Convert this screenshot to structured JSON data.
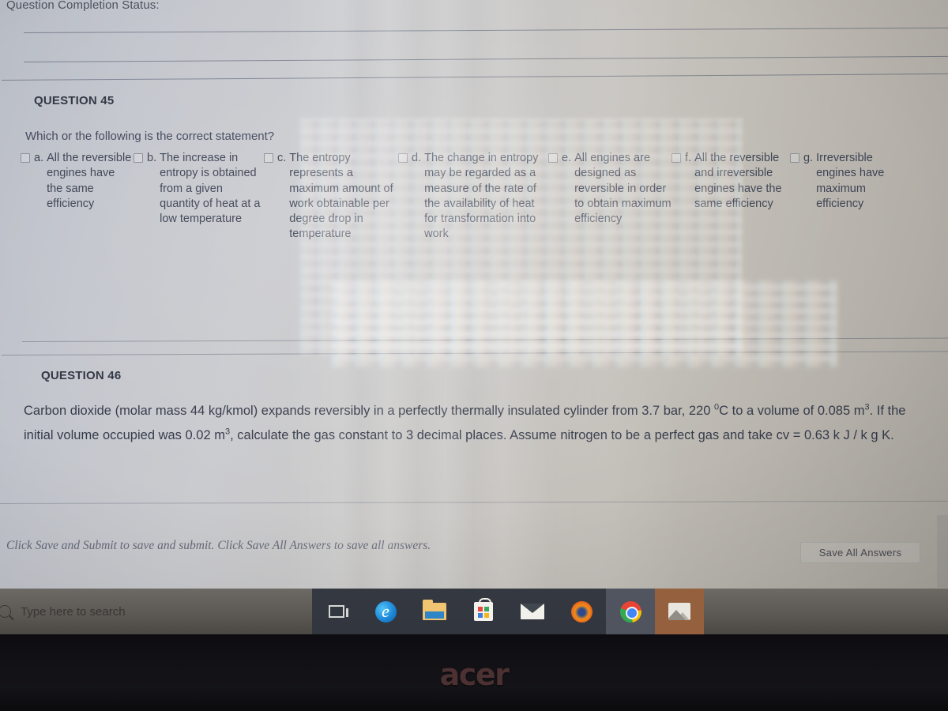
{
  "header": {
    "status_label": "Question Completion Status:"
  },
  "question45": {
    "heading": "QUESTION 45",
    "prompt": "Which or the following is the correct statement?",
    "options": [
      {
        "letter": "a.",
        "text": "All the reversible engines have the same efficiency",
        "checked": false
      },
      {
        "letter": "b.",
        "text": "The increase in entropy is obtained from a given quantity of heat at a low temperature",
        "checked": false
      },
      {
        "letter": "c.",
        "text": "The entropy represents a maximum amount of work obtainable per degree drop in temperature",
        "checked": false
      },
      {
        "letter": "d.",
        "text": "The change in entropy may be regarded as a measure of the rate of the availability of heat for transformation into work",
        "checked": false
      },
      {
        "letter": "e.",
        "text": "All engines are designed as reversible in order to obtain maximum efficiency",
        "checked": false
      },
      {
        "letter": "f.",
        "text": "All the reversible and irreversible engines have the same efficiency",
        "checked": false
      },
      {
        "letter": "g.",
        "text": "Irreversible engines have maximum efficiency",
        "checked": false
      }
    ]
  },
  "question46": {
    "heading": "QUESTION 46",
    "body_part1": "Carbon dioxide (molar mass 44 kg/kmol) expands reversibly in a perfectly thermally insulated cylinder from 3.7 bar, 220 ",
    "sup_degree": "0",
    "body_part2": "C to a volume of 0.085 m",
    "sup_cube_1": "3",
    "body_part3": ". If the initial volume occupied was 0.02 m",
    "sup_cube_2": "3",
    "body_part4": ", calculate the gas constant to 3 decimal places. Assume nitrogen to be a perfect gas and take cv = 0.63 k J / k g K."
  },
  "footer": {
    "save_hint": "Click Save and Submit to save and submit. Click Save All Answers to save all answers.",
    "save_all_label": "Save All Answers"
  },
  "taskbar": {
    "search_placeholder": "Type here to search",
    "items": [
      {
        "name": "task-view",
        "label": "Task View"
      },
      {
        "name": "edge",
        "label": "Microsoft Edge",
        "glyph": "e"
      },
      {
        "name": "file-explorer",
        "label": "File Explorer"
      },
      {
        "name": "microsoft-store",
        "label": "Microsoft Store"
      },
      {
        "name": "mail",
        "label": "Mail"
      },
      {
        "name": "firefox",
        "label": "Mozilla Firefox"
      },
      {
        "name": "chrome",
        "label": "Google Chrome"
      },
      {
        "name": "photos",
        "label": "Photos"
      }
    ]
  },
  "device": {
    "brand": "acer"
  },
  "colors": {
    "page_background": "#c6c7cb",
    "text": "#3b4152",
    "heading": "#2f3441",
    "taskbar": "#5b5853",
    "bezel": "#121115",
    "acer_logo": "#5c3a3c"
  }
}
